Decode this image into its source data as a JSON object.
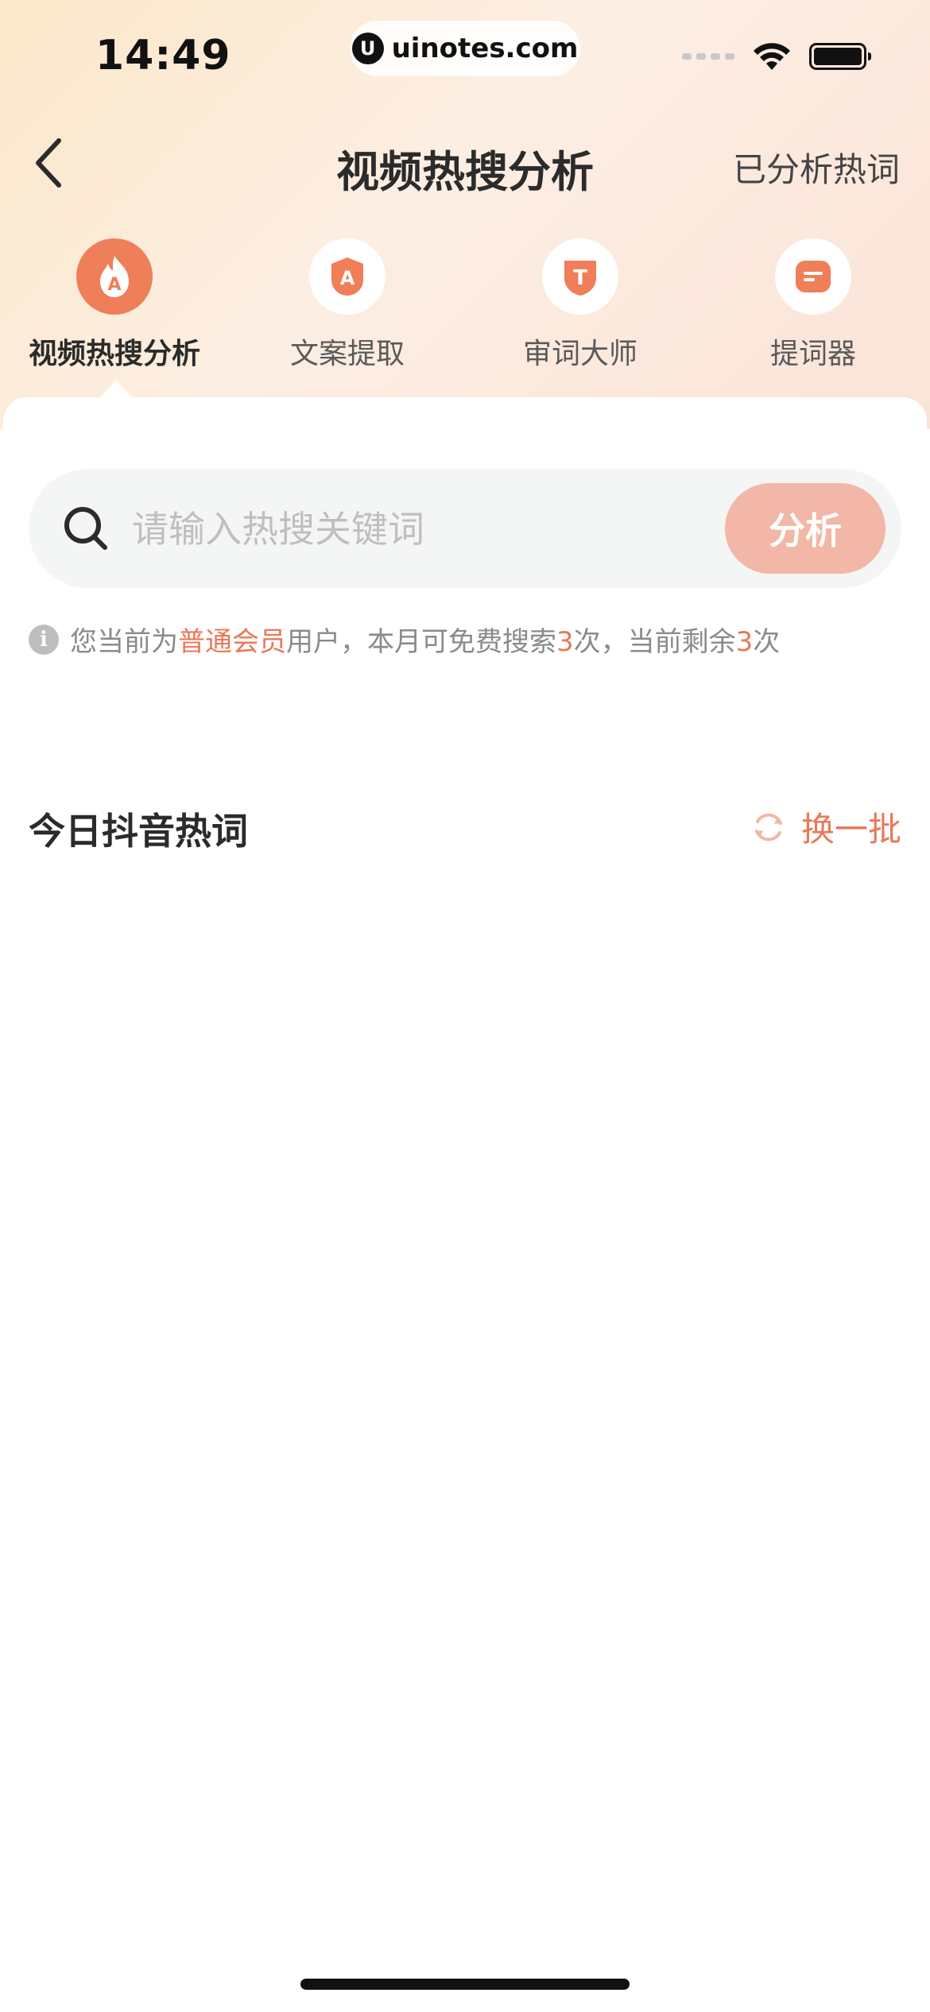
{
  "status_bar": {
    "time": "14:49",
    "url": "uinotes.com"
  },
  "nav": {
    "title": "视频热搜分析",
    "right_label": "已分析热词"
  },
  "tabs": [
    {
      "label": "视频热搜分析",
      "icon": "flame-a-icon",
      "active": true
    },
    {
      "label": "文案提取",
      "icon": "letter-a-badge-icon",
      "active": false
    },
    {
      "label": "审词大师",
      "icon": "letter-t-shield-icon",
      "active": false
    },
    {
      "label": "提词器",
      "icon": "teleprompter-icon",
      "active": false
    }
  ],
  "search": {
    "placeholder": "请输入热搜关键词",
    "button_label": "分析"
  },
  "quota": {
    "prefix": "您当前为",
    "member_type": "普通会员",
    "middle": "用户，本月可免费搜索",
    "free_count": "3",
    "middle2": "次，当前剩余",
    "remaining": "3",
    "suffix": "次"
  },
  "hot_words": {
    "title": "今日抖音热词",
    "refresh_label": "换一批"
  },
  "colors": {
    "accent": "#ef7f59",
    "button_disabled": "#f2b7a6",
    "text_accent": "#e8795a"
  }
}
